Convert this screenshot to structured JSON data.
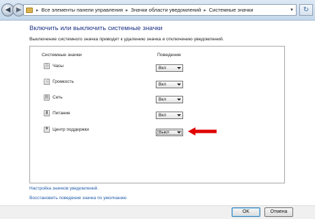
{
  "address_bar": {
    "separator": "▸",
    "crumbs": [
      "Все элементы панели управления",
      "Значки области уведомлений",
      "Системные значки"
    ]
  },
  "nav": {
    "back_glyph": "◀",
    "forward_glyph": "▶",
    "refresh_glyph": "↻",
    "dropdown_glyph": "▼"
  },
  "page": {
    "title": "Включить или выключить системные значки",
    "subtitle": "Выключение системного значка приводит к удалению значка и отключению уведомлений."
  },
  "table": {
    "header_icons": "Системные значки",
    "header_behavior": "Поведение",
    "rows": [
      {
        "label": "Часы",
        "value": "Вкл",
        "icon": "clock-icon"
      },
      {
        "label": "Громкость",
        "value": "Вкл",
        "icon": "volume-icon"
      },
      {
        "label": "Сеть",
        "value": "Вкл",
        "icon": "network-icon"
      },
      {
        "label": "Питание",
        "value": "Вкл",
        "icon": "power-icon"
      },
      {
        "label": "Центр поддержки",
        "value": "Выкл",
        "icon": "flag-icon"
      }
    ]
  },
  "links": {
    "customize": "Настройка значков уведомлений.",
    "restore": "Восстановить поведение значка по умолчанию"
  },
  "buttons": {
    "ok": "OK",
    "cancel": "Отмена"
  },
  "colors": {
    "title": "#1e3287",
    "link": "#1f5aa8",
    "arrow": "#e00000"
  }
}
